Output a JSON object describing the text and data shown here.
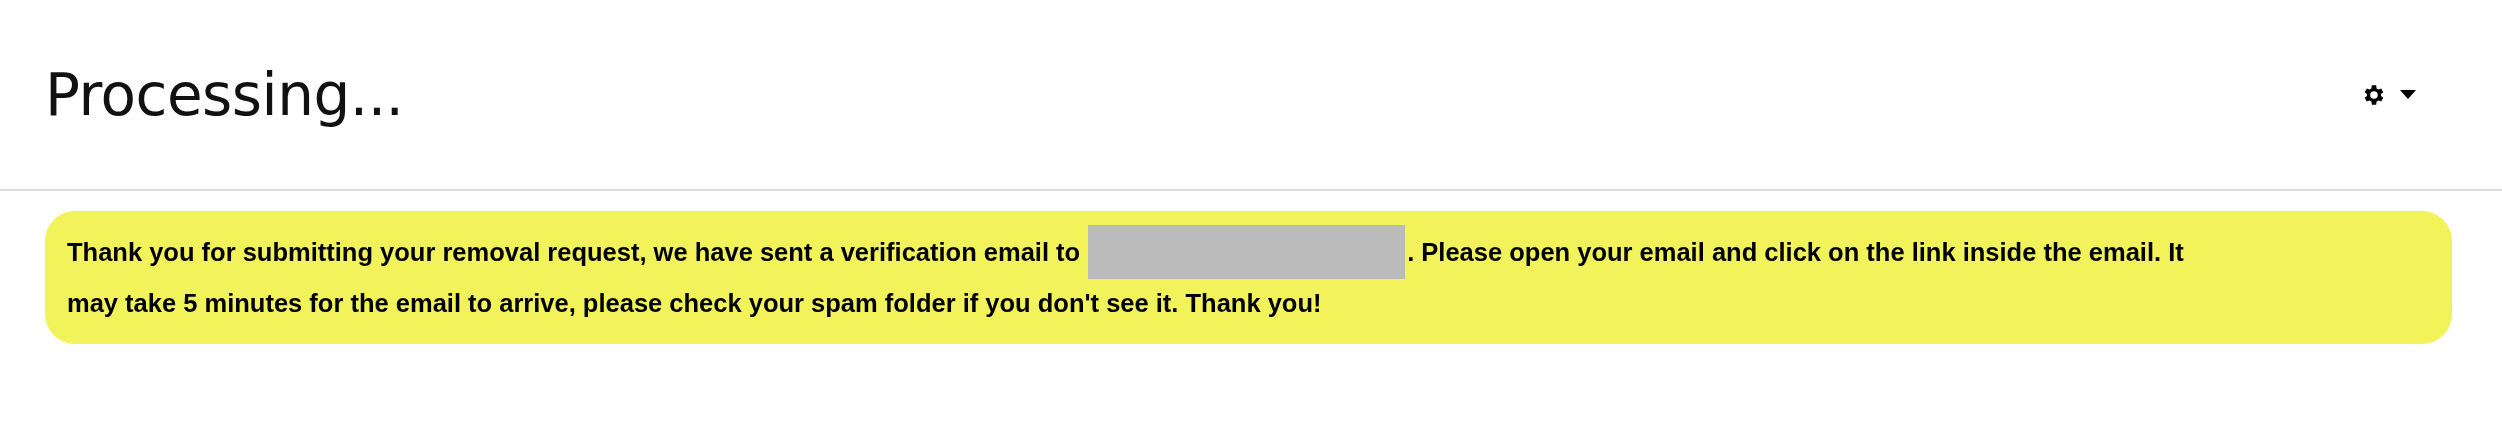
{
  "header": {
    "title": "Processing..."
  },
  "notice": {
    "line_1_before": "Thank you for submitting your removal request, we have sent a verification email to",
    "email_redacted": true,
    "line_1_after": ". Please open your email and click on the link inside the email. It",
    "line_2": "may take 5 minutes for the email to arrive, please check your spam folder if you don't see it. Thank you!"
  }
}
